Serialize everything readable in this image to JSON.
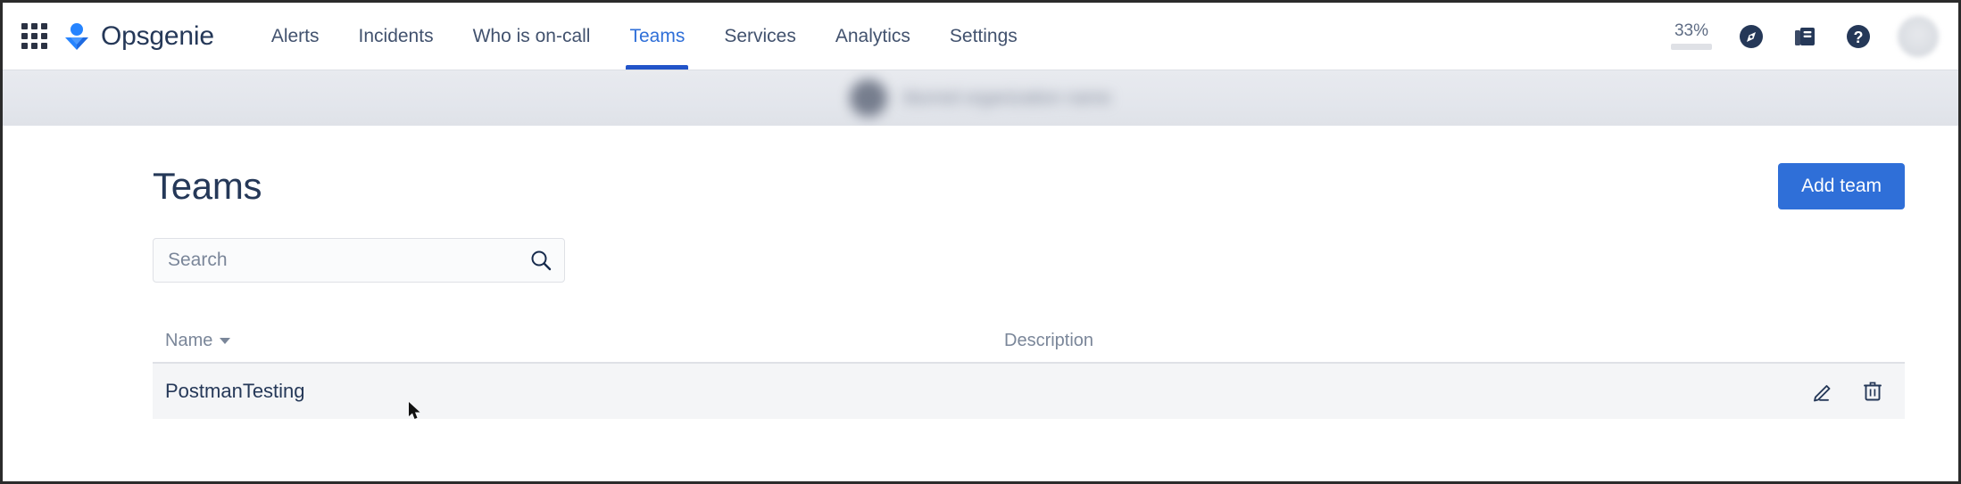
{
  "brand": {
    "name": "Opsgenie",
    "app_switcher_icon": "grid-apps-icon",
    "logo_icon": "opsgenie-logo-icon"
  },
  "nav": {
    "items": [
      {
        "label": "Alerts",
        "active": false
      },
      {
        "label": "Incidents",
        "active": false
      },
      {
        "label": "Who is on-call",
        "active": false
      },
      {
        "label": "Teams",
        "active": true
      },
      {
        "label": "Services",
        "active": false
      },
      {
        "label": "Analytics",
        "active": false
      },
      {
        "label": "Settings",
        "active": false
      }
    ]
  },
  "nav_right": {
    "usage_percent_label": "33%",
    "usage_percent_value": 33,
    "compass_icon": "compass-icon",
    "docs_icon": "book-docs-icon",
    "help_icon": "help-question-icon",
    "avatar_icon": "user-avatar"
  },
  "org_banner": {
    "text": "blurred organization name",
    "avatar_icon": "org-avatar"
  },
  "page": {
    "title": "Teams",
    "add_team_label": "Add team"
  },
  "search": {
    "value": "",
    "placeholder": "Search",
    "icon": "search-icon"
  },
  "table": {
    "columns": {
      "name": "Name",
      "description": "Description"
    },
    "sort_indicator": "sort-desc-caret",
    "rows": [
      {
        "name": "PostmanTesting",
        "description": ""
      }
    ],
    "row_actions": {
      "edit_icon": "pencil-edit-icon",
      "delete_icon": "trash-delete-icon"
    }
  },
  "colors": {
    "accent_blue": "#2f6fd8",
    "active_tab_underline": "#2254c9",
    "heading_navy": "#253858",
    "row_background": "#f4f5f7",
    "usage_bar_fill": "#344563"
  }
}
